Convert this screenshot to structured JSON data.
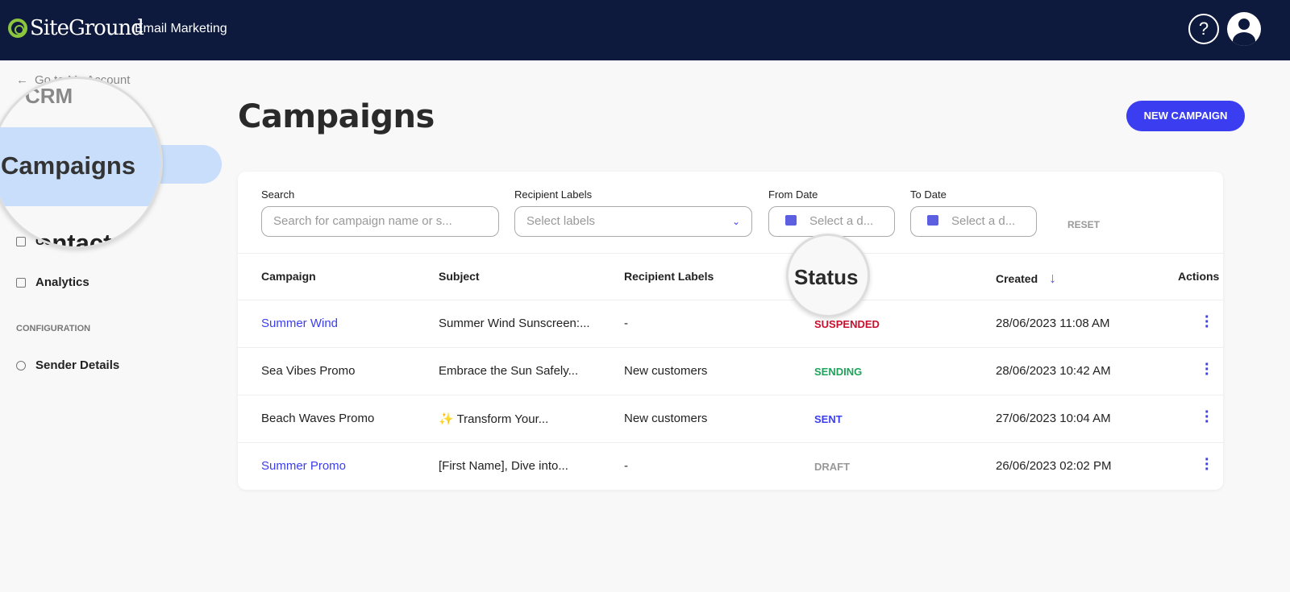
{
  "header": {
    "brand": "SiteGround",
    "product": "Email Marketing",
    "help_icon": "question-circle-icon",
    "avatar_icon": "user-avatar-icon"
  },
  "sidebar": {
    "back": "Go to My Account",
    "section_crm": "CRM",
    "items": [
      {
        "label": "Campaigns",
        "active": true
      },
      {
        "label": "Contacts",
        "icon": "tag-icon"
      },
      {
        "label": "Analytics",
        "icon": "chart-icon"
      }
    ],
    "section_config": "CONFIGURATION",
    "config_items": [
      {
        "label": "Sender Details",
        "icon": "gear-icon"
      }
    ]
  },
  "magnifier": {
    "left_section": "CRM",
    "left_item": "Campaigns",
    "left_bottom": "Contacts",
    "status": "Status"
  },
  "page": {
    "title": "Campaigns",
    "new_button": "NEW CAMPAIGN",
    "accent": "#3b3ef0"
  },
  "filters": {
    "search_label": "Search",
    "search_placeholder": "Search for campaign name or s...",
    "labels_label": "Recipient Labels",
    "labels_placeholder": "Select labels",
    "from_label": "From Date",
    "from_placeholder": "Select a d...",
    "to_label": "To Date",
    "to_placeholder": "Select a d...",
    "reset": "RESET"
  },
  "table": {
    "columns": [
      "Campaign",
      "Subject",
      "Recipient Labels",
      "Status",
      "Created",
      "Actions"
    ],
    "sort": "Created descending",
    "rows": [
      {
        "campaign": "Summer Wind",
        "link": true,
        "subject": "Summer Wind Sunscreen:...",
        "labels": "-",
        "status": "SUSPENDED",
        "status_color": "#c8102e",
        "created": "28/06/2023 11:08 AM"
      },
      {
        "campaign": "Sea Vibes Promo",
        "link": false,
        "subject": "Embrace the Sun Safely...",
        "labels": "New customers",
        "status": "SENDING",
        "status_color": "#1ea45a",
        "created": "28/06/2023 10:42 AM"
      },
      {
        "campaign": "Beach Waves Promo",
        "link": false,
        "subject": "✨ Transform Your...",
        "labels": "New customers",
        "status": "SENT",
        "status_color": "#3b3ef0",
        "created": "27/06/2023 10:04 AM"
      },
      {
        "campaign": "Summer Promo",
        "link": true,
        "subject": "[First Name], Dive into...",
        "labels": "-",
        "status": "DRAFT",
        "status_color": "#999999",
        "created": "26/06/2023 02:02 PM"
      }
    ]
  }
}
